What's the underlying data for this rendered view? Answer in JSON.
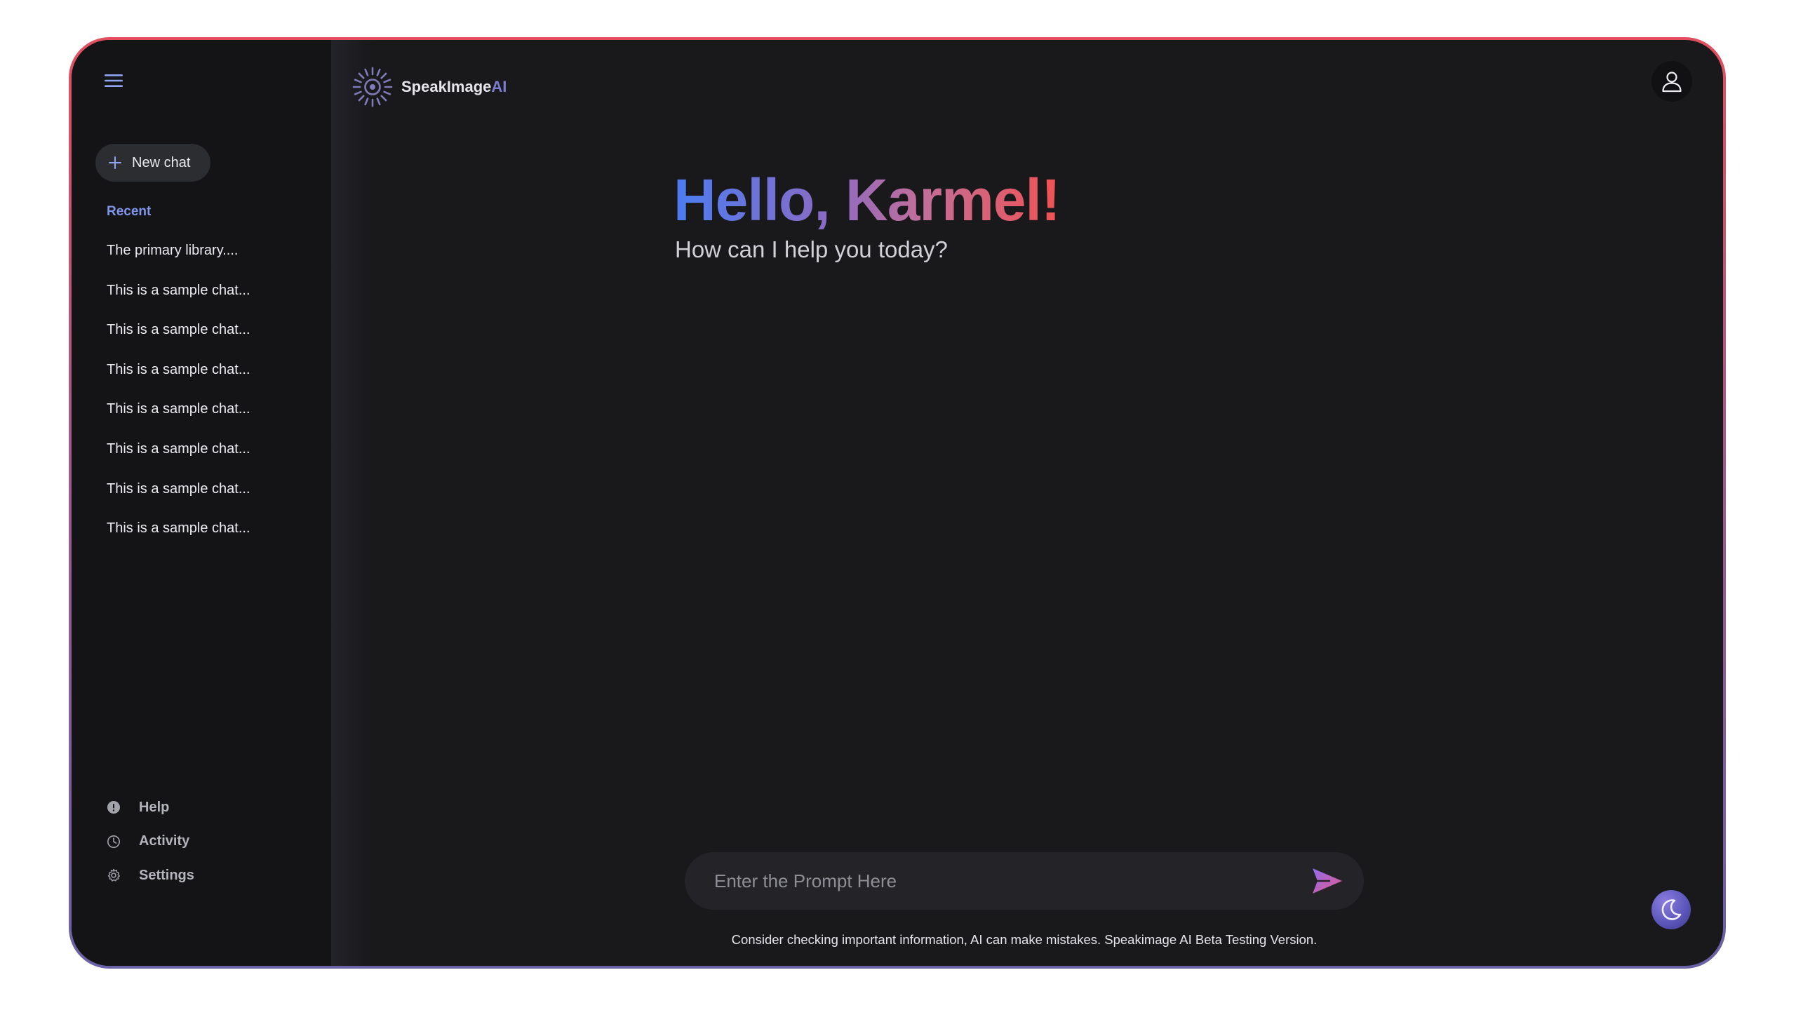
{
  "brand": {
    "name_main": "SpeakImage",
    "name_suffix": "AI"
  },
  "sidebar": {
    "new_chat_label": "New chat",
    "recent_label": "Recent",
    "chats": [
      "The primary library....",
      "This is a sample chat...",
      "This is a sample chat...",
      "This is a sample chat...",
      "This is a sample chat...",
      "This is a sample chat...",
      "This is a sample chat...",
      "This is a sample chat..."
    ],
    "bottom": [
      {
        "label": "Help",
        "icon": "info-icon"
      },
      {
        "label": "Activity",
        "icon": "clock-icon"
      },
      {
        "label": "Settings",
        "icon": "gear-icon"
      }
    ]
  },
  "main": {
    "greeting": "Hello, Karmel!",
    "subgreeting": "How can I help you today?",
    "prompt_placeholder": "Enter the Prompt Here",
    "disclaimer": "Consider checking important information, AI can make mistakes. Speakimage AI Beta Testing Version."
  },
  "colors": {
    "frame_gradient": [
      "#e2505f",
      "#6a62a6"
    ],
    "accent_blue": "#7f96ea",
    "greeting_gradient": [
      "#4b7df2",
      "#f05252"
    ]
  }
}
